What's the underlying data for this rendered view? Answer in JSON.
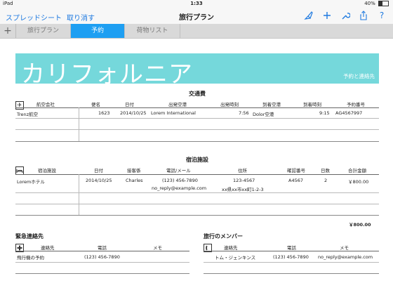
{
  "status": {
    "carrier": "iPad",
    "time": "1:33",
    "battery": "40%"
  },
  "nav": {
    "left1": "スプレッドシート",
    "left2": "取り消す",
    "title": "旅行プラン"
  },
  "tabs": {
    "plus": "+",
    "items": [
      "旅行プラン",
      "予約",
      "荷物リスト"
    ],
    "active": 1
  },
  "banner": {
    "title": "カリフォルニア",
    "subtitle": "予約と連絡先"
  },
  "transport": {
    "title": "交通費",
    "headers": [
      "航空会社",
      "便名",
      "日付",
      "出発空港",
      "出発時刻",
      "到着空港",
      "到着時刻",
      "予約番号"
    ],
    "row": [
      "Trenz航空",
      "1623",
      "2014/10/25",
      "Lorem International",
      "7:56",
      "Dolor空港",
      "9:15",
      "AG4567997"
    ]
  },
  "lodging": {
    "title": "宿泊施設",
    "headers": [
      "宿泊施設",
      "日付",
      "接客係",
      "電話/メール",
      "住所",
      "確認番号",
      "日数",
      "合計金額"
    ],
    "row": {
      "name": "Loremホテル",
      "date": "2014/10/25",
      "agent": "Charles",
      "phone": "(123) 456-7890",
      "email": "no_reply@example.com",
      "addr1": "123-4567",
      "addr2": "xx県xx市xx町1-2-3",
      "confirm": "A4567",
      "days": "2",
      "total": "￥800.00"
    },
    "grand_total": "￥800.00"
  },
  "emergency": {
    "title": "緊急連絡先",
    "headers": [
      "連絡先",
      "電話",
      "メモ"
    ],
    "row": [
      "飛行機の予約",
      "(123) 456-7890",
      ""
    ]
  },
  "members": {
    "title": "旅行のメンバー",
    "headers": [
      "連絡先",
      "電話",
      "メモ"
    ],
    "row": [
      "トム・ジェンキンス",
      "(123) 456-7890",
      "no_reply@example.com"
    ]
  }
}
